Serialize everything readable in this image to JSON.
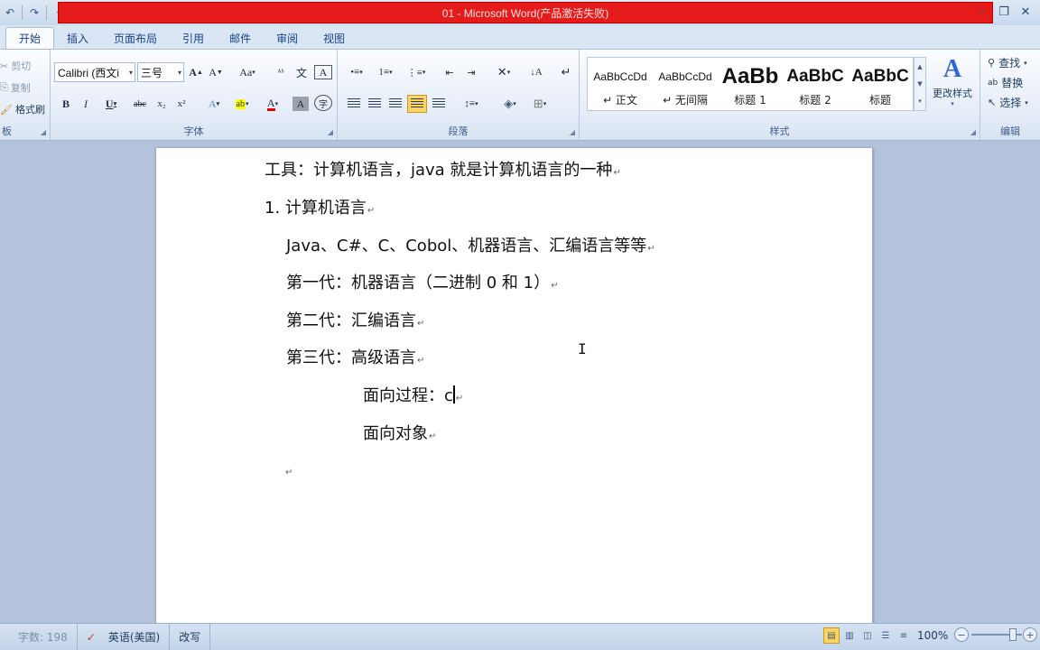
{
  "window": {
    "title": "01  -  Microsoft Word(产品激活失败)"
  },
  "tabs": [
    {
      "label": "开始",
      "active": true
    },
    {
      "label": "插入"
    },
    {
      "label": "页面布局"
    },
    {
      "label": "引用"
    },
    {
      "label": "邮件"
    },
    {
      "label": "审阅"
    },
    {
      "label": "视图"
    }
  ],
  "clipboard": {
    "cut": "剪切",
    "copy": "复制",
    "format_painter": "格式刷",
    "group_label": "板"
  },
  "font": {
    "name": "Calibri (西文i",
    "size": "三号",
    "group_label": "字体",
    "grow": "A",
    "shrink": "A",
    "case": "Aa",
    "bold": "B",
    "italic": "I",
    "underline": "U",
    "strike": "abc",
    "subscript": "x₂",
    "superscript": "x²",
    "font_color": "A",
    "shade": "A",
    "phonetic": "文",
    "border_char": "A",
    "enclose": "字"
  },
  "paragraph": {
    "group_label": "段落"
  },
  "styles": {
    "group_label": "样式",
    "items": [
      {
        "sample": "AaBbCcDd",
        "name": "↵ 正文"
      },
      {
        "sample": "AaBbCcDd",
        "name": "↵ 无间隔"
      },
      {
        "sample": "AaBb",
        "name": "标题 1"
      },
      {
        "sample": "AaBbC",
        "name": "标题 2"
      },
      {
        "sample": "AaBbC",
        "name": "标题"
      }
    ],
    "change_styles": "更改样式"
  },
  "editing": {
    "group_label": "编辑",
    "find": "查找",
    "replace": "替换",
    "select": "选择"
  },
  "document": {
    "lines": [
      "工具：计算机语言，java 就是计算机语言的一种",
      "1. 计算机语言",
      "Java、C#、C、Cobol、机器语言、汇编语言等等",
      "第一代：机器语言（二进制  0 和 1）",
      "第二代：汇编语言",
      "第三代：高级语言",
      "面向过程：c",
      "面向对象",
      ""
    ],
    "para_mark": "↵"
  },
  "statusbar": {
    "word_count": "字数: 198",
    "language": "英语(美国)",
    "mode": "改写",
    "zoom": "100%",
    "zoom_level": 1.0
  },
  "colors": {
    "title_bar": "#e51b1b",
    "ribbon": "#e5edf8",
    "selected_button": "#ffd45e"
  }
}
